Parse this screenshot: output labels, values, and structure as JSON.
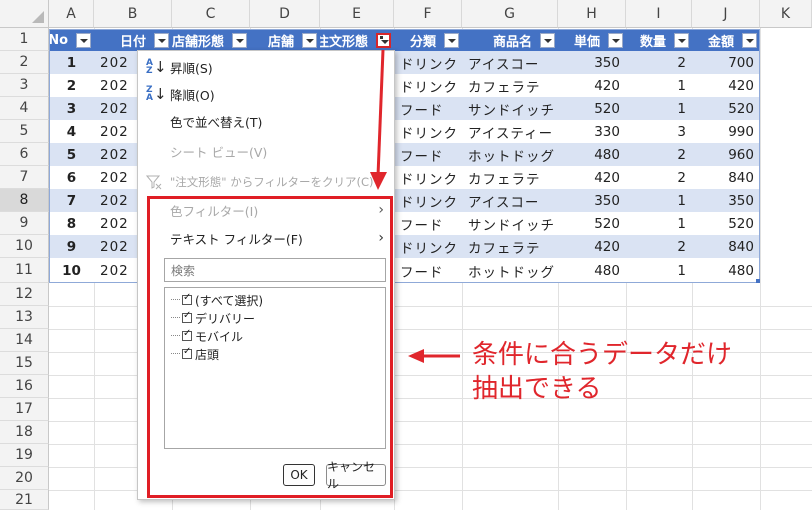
{
  "columns": [
    "A",
    "B",
    "C",
    "D",
    "E",
    "F",
    "G",
    "H",
    "I",
    "J",
    "K"
  ],
  "rows": [
    "1",
    "2",
    "3",
    "4",
    "5",
    "6",
    "7",
    "8",
    "9",
    "10",
    "11",
    "12",
    "13",
    "14",
    "15",
    "16",
    "17",
    "18",
    "19",
    "20",
    "21"
  ],
  "selected_row": "8",
  "table": {
    "headers": [
      "No",
      "日付",
      "店舗形態",
      "店舗",
      "注文形態",
      "分類",
      "商品名",
      "単価",
      "数量",
      "金額"
    ],
    "rows": [
      {
        "no": "1",
        "date": "202",
        "cat": "ドリンク",
        "product": "アイスコー",
        "price": "350",
        "qty": "2",
        "amount": "700"
      },
      {
        "no": "2",
        "date": "202",
        "cat": "ドリンク",
        "product": "カフェラテ",
        "price": "420",
        "qty": "1",
        "amount": "420"
      },
      {
        "no": "3",
        "date": "202",
        "cat": "フード",
        "product": "サンドイッチ",
        "price": "520",
        "qty": "1",
        "amount": "520"
      },
      {
        "no": "4",
        "date": "202",
        "cat": "ドリンク",
        "product": "アイスティー",
        "price": "330",
        "qty": "3",
        "amount": "990"
      },
      {
        "no": "5",
        "date": "202",
        "cat": "フード",
        "product": "ホットドッグ",
        "price": "480",
        "qty": "2",
        "amount": "960"
      },
      {
        "no": "6",
        "date": "202",
        "cat": "ドリンク",
        "product": "カフェラテ",
        "price": "420",
        "qty": "2",
        "amount": "840"
      },
      {
        "no": "7",
        "date": "202",
        "cat": "ドリンク",
        "product": "アイスコー",
        "price": "350",
        "qty": "1",
        "amount": "350"
      },
      {
        "no": "8",
        "date": "202",
        "cat": "フード",
        "product": "サンドイッチ",
        "price": "520",
        "qty": "1",
        "amount": "520"
      },
      {
        "no": "9",
        "date": "202",
        "cat": "ドリンク",
        "product": "カフェラテ",
        "price": "420",
        "qty": "2",
        "amount": "840"
      },
      {
        "no": "10",
        "date": "202",
        "cat": "フード",
        "product": "ホットドッグ",
        "price": "480",
        "qty": "1",
        "amount": "480"
      }
    ]
  },
  "menu": {
    "sort_asc": "昇順(S)",
    "sort_desc": "降順(O)",
    "sort_by_color": "色で並べ替え(T)",
    "sheet_view": "シート ビュー(V)",
    "clear_filter": "\"注文形態\" からフィルターをクリア(C)",
    "color_filter": "色フィルター(I)",
    "text_filter": "テキスト フィルター(F)",
    "search_placeholder": "検索",
    "options": [
      "(すべて選択)",
      "デリバリー",
      "モバイル",
      "店頭"
    ],
    "ok": "OK",
    "cancel": "キャンセル"
  },
  "annotation": {
    "line1": "条件に合うデータだけ",
    "line2": "抽出できる",
    "color": "#e0262c"
  }
}
